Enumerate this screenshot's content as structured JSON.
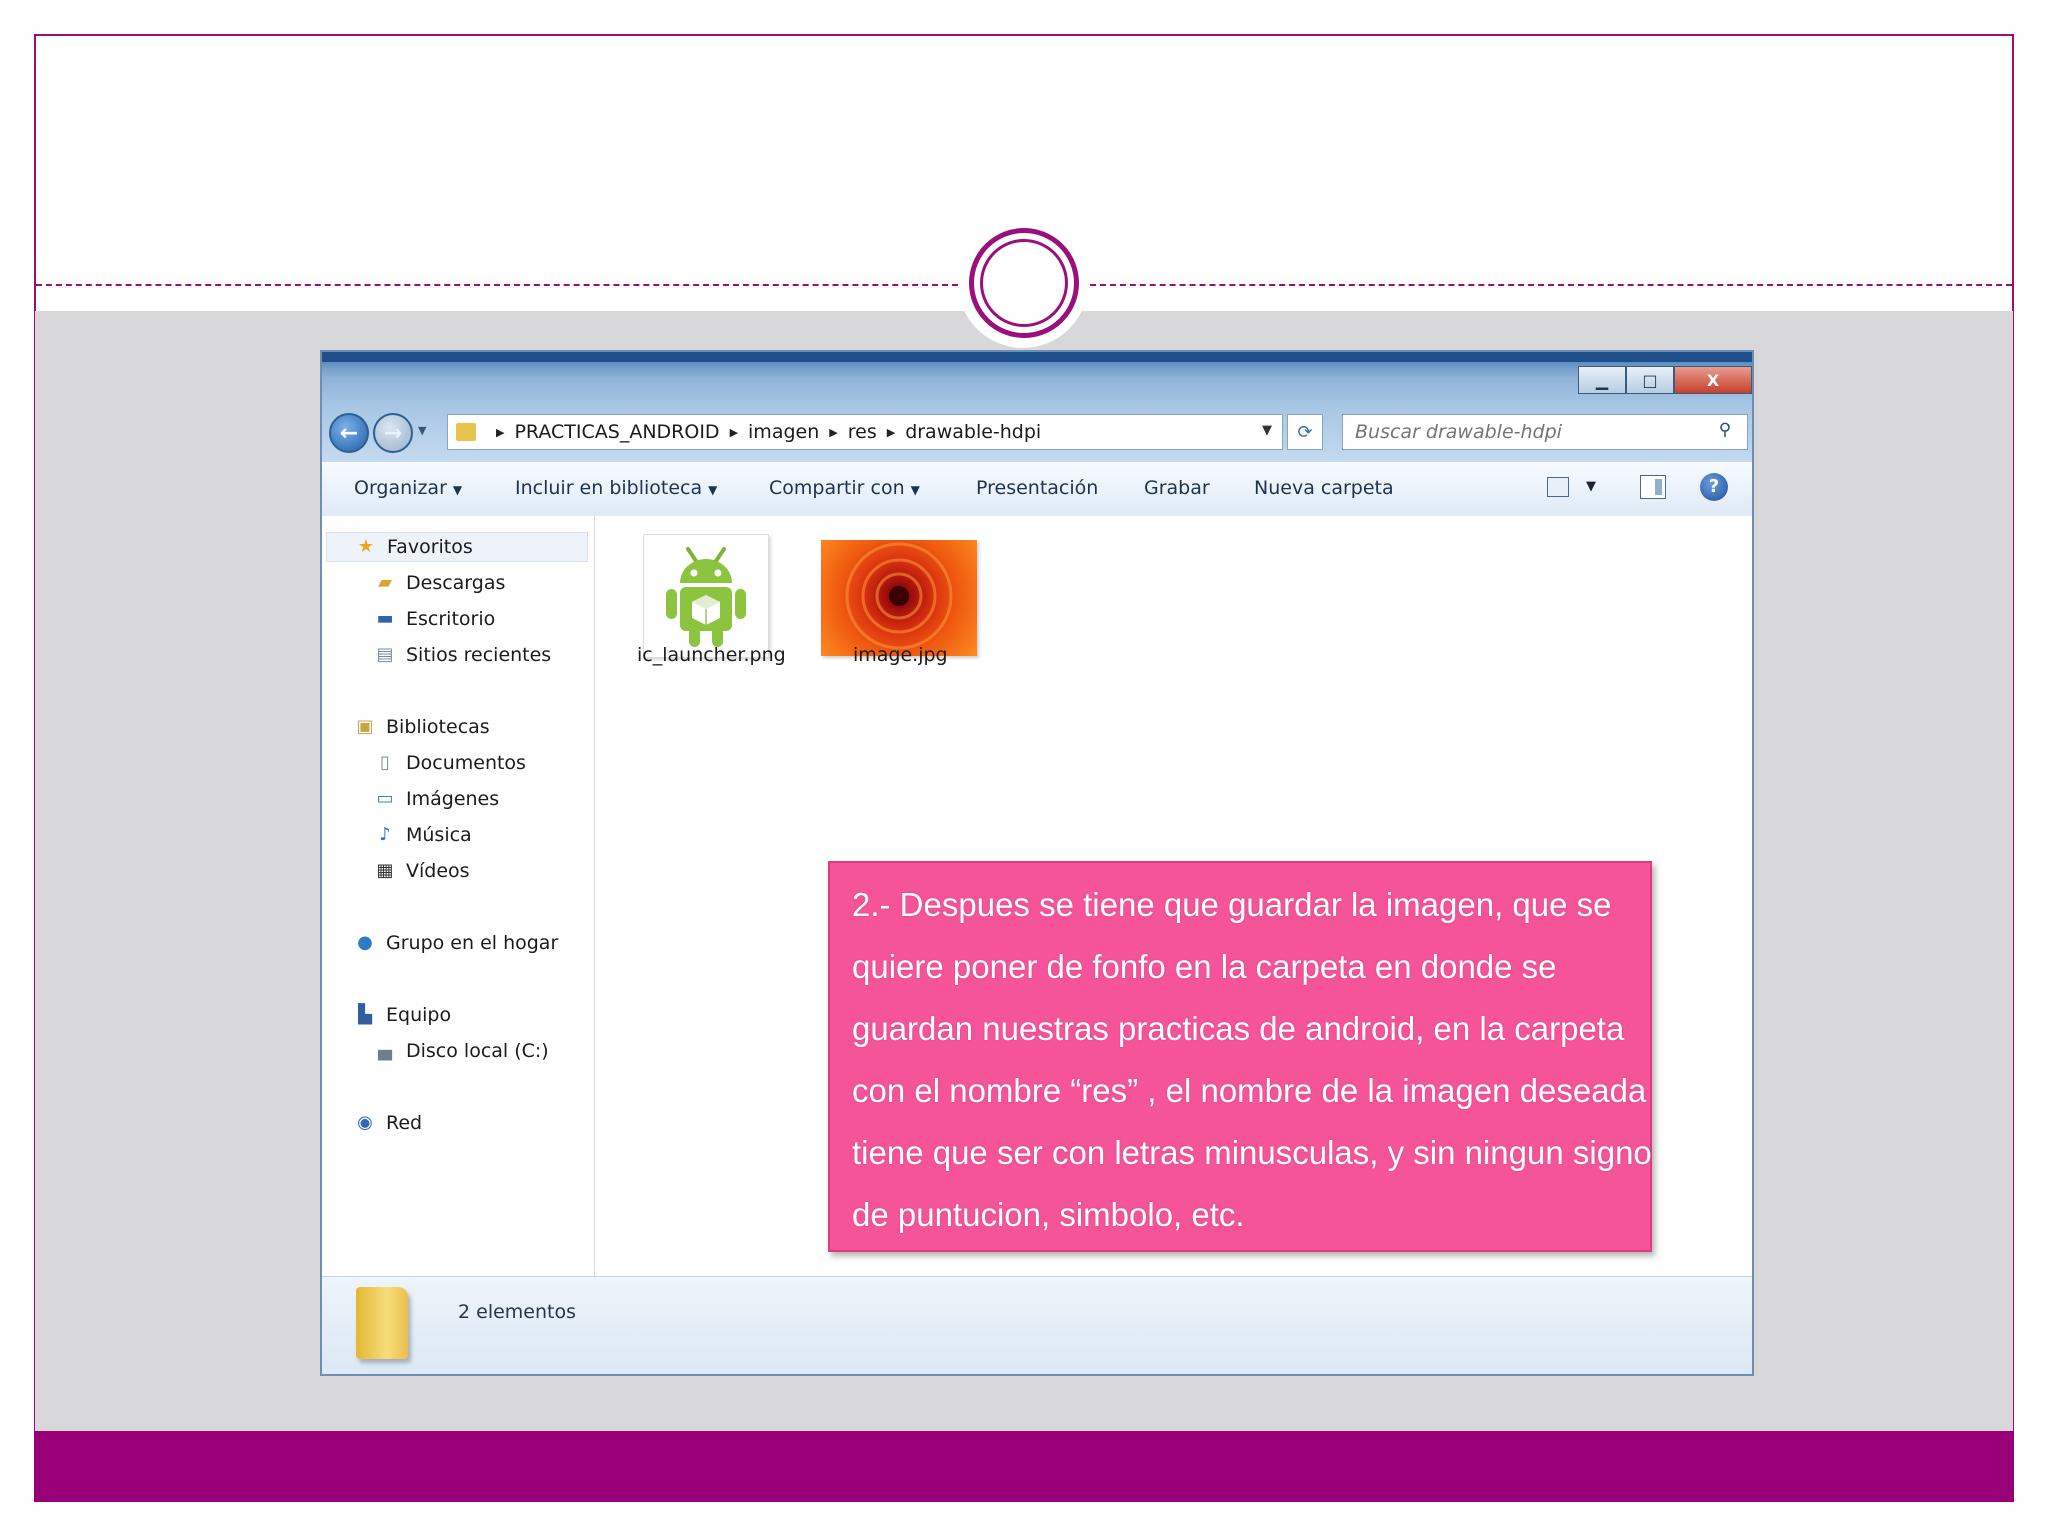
{
  "explorer": {
    "breadcrumb": [
      "PRACTICAS_ANDROID",
      "imagen",
      "res",
      "drawable-hdpi"
    ],
    "search_placeholder": "Buscar drawable-hdpi",
    "window_buttons": {
      "minimize": "▁",
      "maximize": "□",
      "close": "X"
    },
    "toolbar": {
      "organize": "Organizar",
      "include_library": "Incluir en biblioteca",
      "share": "Compartir con",
      "presentation": "Presentación",
      "burn": "Grabar",
      "new_folder": "Nueva carpeta",
      "help": "?"
    },
    "nav": {
      "favorites": "Favoritos",
      "downloads": "Descargas",
      "desktop": "Escritorio",
      "recent": "Sitios recientes",
      "libraries": "Bibliotecas",
      "documents": "Documentos",
      "images": "Imágenes",
      "music": "Música",
      "videos": "Vídeos",
      "homegroup": "Grupo en el hogar",
      "computer": "Equipo",
      "local_disk": "Disco local (C:)",
      "network": "Red"
    },
    "files": [
      {
        "name": "ic_launcher.png",
        "icon": "android-icon"
      },
      {
        "name": "image.jpg",
        "icon": "flower-image"
      }
    ],
    "status": "2 elementos"
  },
  "callout": {
    "text": "2.- Despues se tiene que guardar la imagen, que se quiere poner de fonfo en la carpeta en donde se guardan nuestras practicas de android, en la carpeta con el nombre “res” , el nombre de la imagen deseada tiene que ser con letras minusculas, y sin ningun signo de puntucion, simbolo, etc."
  },
  "colors": {
    "accent": "#990077",
    "callout": "#f55499",
    "slide_body": "#d8d8da"
  }
}
